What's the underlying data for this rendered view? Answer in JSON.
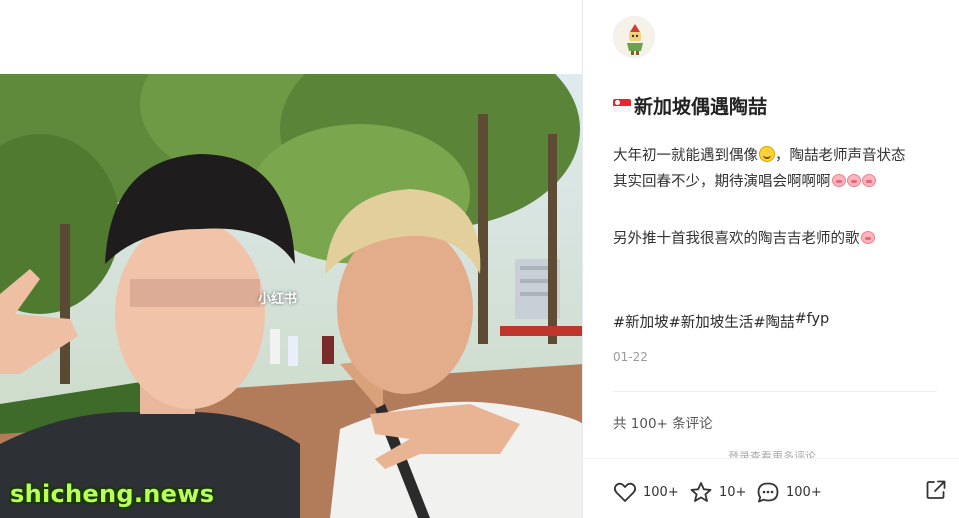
{
  "watermarks": {
    "app": "小红书",
    "site": "shicheng.news"
  },
  "post": {
    "title": "新加坡偶遇陶喆",
    "desc_line1a": "大年初一就能遇到偶像",
    "desc_line1b": "，陶喆老师声音状态",
    "desc_line2": "其实回春不少，期待演唱会啊啊啊",
    "desc_line3": "另外推十首我很喜欢的陶吉吉老师的歌",
    "tags": [
      "#新加坡",
      "#新加坡生活",
      "#陶喆",
      "#fyp"
    ],
    "date": "01-22"
  },
  "comments": {
    "count_label": "共 100+ 条评论",
    "login_hint": "登录查看更多评论"
  },
  "actions": {
    "likes": "100+",
    "collects": "10+",
    "comments": "100+"
  },
  "icons": [
    "avatar-image",
    "singapore-flag-icon",
    "smile-emoji-icon",
    "pig-emoji-icon",
    "heart-icon",
    "star-icon",
    "comment-icon",
    "share-icon"
  ],
  "colors": {
    "text": "#333333",
    "muted": "#999999",
    "watermark_site": "#b9ff5a"
  }
}
